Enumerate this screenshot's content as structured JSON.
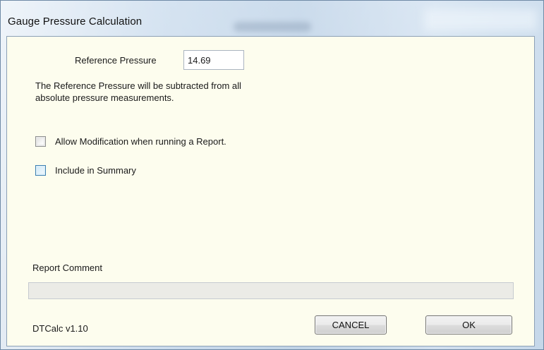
{
  "window": {
    "title": "Gauge Pressure Calculation"
  },
  "reference": {
    "label": "Reference Pressure",
    "value": "14.69",
    "description_line1": "The Reference Pressure will be subtracted from all",
    "description_line2": "absolute pressure measurements."
  },
  "options": {
    "allow_modification_label": "Allow Modification when running a Report.",
    "allow_modification_checked": false,
    "include_summary_label": "Include in Summary",
    "include_summary_checked": false
  },
  "comment": {
    "label": "Report Comment",
    "value": ""
  },
  "footer": {
    "version": "DTCalc v1.10",
    "cancel_label": "CANCEL",
    "ok_label": "OK"
  },
  "colors": {
    "client_background": "#fdfdee",
    "comment_box": "#ebebe6",
    "checkbox_hover_border": "#3c7fb1"
  },
  "icons": {
    "checkbox_unchecked": "checkbox-unchecked-icon"
  }
}
